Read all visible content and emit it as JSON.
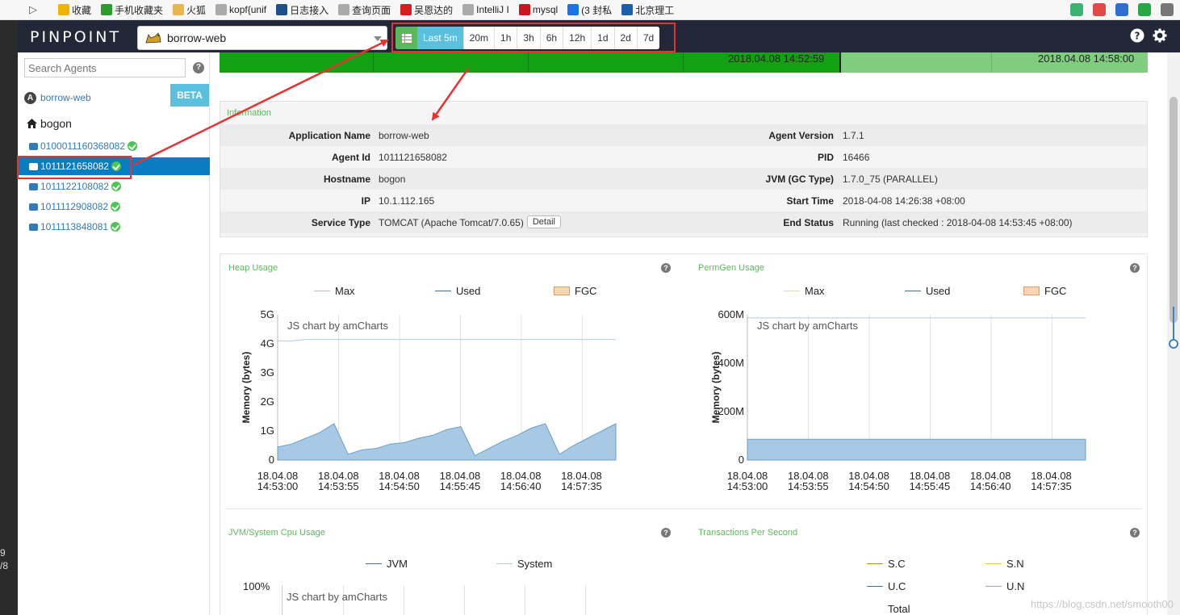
{
  "bookmarks": [
    {
      "label": "收藏",
      "color": "#f0b400"
    },
    {
      "label": "手机收藏夹",
      "color": "#2d9b2d"
    },
    {
      "label": "火狐",
      "color": "#e8b64d"
    },
    {
      "label": "kopf{unif",
      "color": "#aaaaaa"
    },
    {
      "label": "日志接入",
      "color": "#1d4f8a"
    },
    {
      "label": "查询页面",
      "color": "#aaaaaa"
    },
    {
      "label": "吴恩达的",
      "color": "#d62020"
    },
    {
      "label": "IntelliJ I",
      "color": "#aaaaaa"
    },
    {
      "label": "mysql",
      "color": "#c7161d"
    },
    {
      "label": "(3 封私",
      "color": "#1a74e8"
    },
    {
      "label": "北京理工",
      "color": "#1b5fa8"
    }
  ],
  "left_strip": {
    "line1": "9",
    "line2": "/8"
  },
  "header": {
    "logo": "PINPOINT",
    "app_name": "borrow-web",
    "ranges": [
      "Last 5m",
      "20m",
      "1h",
      "3h",
      "6h",
      "12h",
      "1d",
      "2d",
      "7d"
    ],
    "active_range": "Last 5m"
  },
  "sidebar": {
    "search_placeholder": "Search Agents",
    "app_badge": "A",
    "app_name": "borrow-web",
    "beta": "BETA",
    "host": "bogon",
    "agents": [
      {
        "id": "0100011160368082",
        "selected": false
      },
      {
        "id": "1011121658082",
        "selected": true
      },
      {
        "id": "1011122108082",
        "selected": false
      },
      {
        "id": "1011112908082",
        "selected": false
      },
      {
        "id": "1011113848081",
        "selected": false
      }
    ]
  },
  "timeline": {
    "ts1": "2018.04.08 14:52:59",
    "ts2": "2018.04.08 14:58:00"
  },
  "information": {
    "title": "Information",
    "left": [
      {
        "label": "Application Name",
        "value": "borrow-web"
      },
      {
        "label": "Agent Id",
        "value": "1011121658082"
      },
      {
        "label": "Hostname",
        "value": "bogon"
      },
      {
        "label": "IP",
        "value": "10.1.112.165"
      },
      {
        "label": "Service Type",
        "value": "TOMCAT (Apache Tomcat/7.0.65)"
      }
    ],
    "right": [
      {
        "label": "Agent Version",
        "value": "1.7.1"
      },
      {
        "label": "PID",
        "value": "16466"
      },
      {
        "label": "JVM (GC Type)",
        "value": "1.7.0_75 (PARALLEL)"
      },
      {
        "label": "Start Time",
        "value": "2018-04-08 14:26:38 +08:00"
      },
      {
        "label": "End Status",
        "value": "Running (last checked : 2018-04-08 14:53:45 +08:00)"
      }
    ],
    "detail_button": "Detail"
  },
  "credit": "JS chart by amCharts",
  "chart_data": [
    {
      "type": "area",
      "title": "Heap Usage",
      "ylabel": "Memory (bytes)",
      "ylim": [
        0,
        5
      ],
      "y_unit": "G",
      "y_ticks": [
        "0",
        "1G",
        "2G",
        "3G",
        "4G",
        "5G"
      ],
      "x_ticks": [
        "18.04.08\n14:53:00",
        "18.04.08\n14:53:55",
        "18.04.08\n14:54:50",
        "18.04.08\n14:55:45",
        "18.04.08\n14:56:40",
        "18.04.08\n14:57:35"
      ],
      "legend": [
        "Max",
        "Used",
        "FGC"
      ],
      "series": [
        {
          "name": "Max",
          "values": [
            4.1,
            4.1,
            4.15,
            4.15,
            4.15,
            4.15,
            4.15,
            4.15,
            4.15,
            4.15,
            4.15,
            4.15,
            4.15,
            4.15,
            4.15,
            4.15,
            4.15,
            4.15,
            4.15,
            4.15,
            4.15,
            4.15,
            4.15,
            4.15,
            4.15
          ]
        },
        {
          "name": "Used",
          "values": [
            0.45,
            0.55,
            0.75,
            0.95,
            1.25,
            0.2,
            0.35,
            0.4,
            0.55,
            0.6,
            0.75,
            0.85,
            1.05,
            1.15,
            0.15,
            0.4,
            0.65,
            0.85,
            1.1,
            1.25,
            0.2,
            0.5,
            0.75,
            1.0,
            1.25
          ]
        }
      ]
    },
    {
      "type": "area",
      "title": "PermGen Usage",
      "ylabel": "Memory (bytes)",
      "ylim": [
        0,
        600
      ],
      "y_unit": "M",
      "y_ticks": [
        "0",
        "200M",
        "400M",
        "600M"
      ],
      "x_ticks": [
        "18.04.08\n14:53:00",
        "18.04.08\n14:53:55",
        "18.04.08\n14:54:50",
        "18.04.08\n14:55:45",
        "18.04.08\n14:56:40",
        "18.04.08\n14:57:35"
      ],
      "legend": [
        "Max",
        "Used",
        "FGC"
      ],
      "series": [
        {
          "name": "Max",
          "values": [
            587,
            587
          ]
        },
        {
          "name": "Used",
          "values": [
            86,
            86
          ]
        }
      ]
    },
    {
      "type": "line",
      "title": "JVM/System Cpu Usage",
      "legend": [
        "JVM",
        "System"
      ],
      "y_ticks": [
        "100%"
      ]
    },
    {
      "type": "line",
      "title": "Transactions Per Second",
      "legend": [
        "S.C",
        "S.N",
        "U.C",
        "U.N",
        "Total"
      ]
    }
  ],
  "colors": {
    "accent_green": "#5cb85c",
    "header_bg": "#222838",
    "selected_bg": "#0a7cc1",
    "area_fill": "#a8c9e3",
    "area_line": "#6a9fc8"
  },
  "watermark": "https://blog.csdn.net/smooth00"
}
